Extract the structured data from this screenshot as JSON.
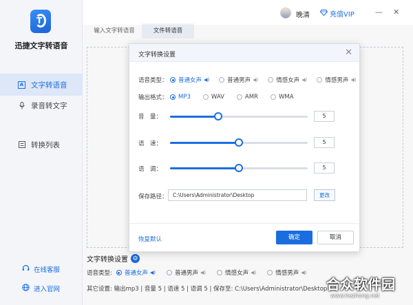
{
  "app": {
    "name": "迅捷文字转语音"
  },
  "sidebar": {
    "items": [
      {
        "label": "文字转语音",
        "icon": "text-a-icon",
        "active": true
      },
      {
        "label": "录音转文字",
        "icon": "microphone-icon",
        "active": false
      },
      {
        "label": "转换列表",
        "icon": "list-icon",
        "active": false
      }
    ],
    "links": [
      {
        "label": "在线客服",
        "icon": "headset-icon"
      },
      {
        "label": "进入官网",
        "icon": "globe-icon"
      }
    ]
  },
  "header": {
    "username": "晚清",
    "vip_label": "充值VIP",
    "minimize": "—",
    "close": "✕"
  },
  "tabs": [
    {
      "label": "输入文字转语音",
      "active": false
    },
    {
      "label": "文件转语音",
      "active": true
    }
  ],
  "modal": {
    "title": "文字转换设置",
    "close": "✕",
    "voice_type_label": "语音类型：",
    "voice_types": [
      {
        "label": "普通女声",
        "selected": true
      },
      {
        "label": "普通男声",
        "selected": false
      },
      {
        "label": "情感女声",
        "selected": false
      },
      {
        "label": "情感男声",
        "selected": false
      }
    ],
    "format_label": "输出格式：",
    "formats": [
      {
        "label": "MP3",
        "selected": true
      },
      {
        "label": "WAV",
        "selected": false
      },
      {
        "label": "AMR",
        "selected": false
      },
      {
        "label": "WMA",
        "selected": false
      }
    ],
    "sliders": [
      {
        "label": "音　量：",
        "value": "5",
        "fraction": 0.35
      },
      {
        "label": "语　速：",
        "value": "5",
        "fraction": 0.5
      },
      {
        "label": "语　调：",
        "value": "5",
        "fraction": 0.5
      }
    ],
    "save_path_label": "保存路径：",
    "save_path": "C:\\Users\\Administrator\\Desktop",
    "change_button": "更改",
    "reset_link": "恢复默认",
    "ok_button": "确定",
    "cancel_button": "取消"
  },
  "bottom": {
    "title": "文字转换设置",
    "voice_type_label": "语音类型:",
    "voice_types": [
      {
        "label": "普通女声",
        "selected": true
      },
      {
        "label": "普通男声",
        "selected": false
      },
      {
        "label": "情感女声",
        "selected": false
      },
      {
        "label": "情感男声",
        "selected": false
      }
    ],
    "other_settings": "其它设置:   输出mp3   |  音量 5  |  语速 5   |  语调 5   |  保存至: C:\\Users\\Administrator\\Desktop"
  },
  "watermark": {
    "big": "合众软件园",
    "small": "www.hezhong.net"
  },
  "colors": {
    "accent": "#1a6de0",
    "sidebar_bg": "#f3f5f9",
    "active_nav_bg": "#dde7f7"
  }
}
